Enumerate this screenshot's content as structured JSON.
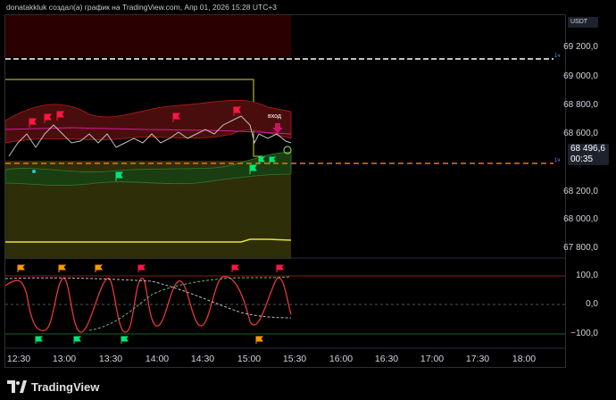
{
  "header": {
    "caption": "donatakkluk создал(а) график на TradingView.com, Апр 01, 2026 15:28 UTC+3"
  },
  "chart": {
    "currency_label": "USDT",
    "last_price": "68 496,6",
    "countdown": "00:35",
    "entry_annotation": "вход",
    "price_axis_labels": [
      "69 200,0",
      "69 000,0",
      "68 800,0",
      "68 600,0",
      "68 200,0",
      "68 000,0",
      "67 800,0"
    ],
    "osc_axis_labels": [
      "100,0",
      "0,0",
      "−100,0"
    ],
    "time_axis_labels": [
      "12:30",
      "13:00",
      "13:30",
      "14:00",
      "14:30",
      "15:00",
      "15:30",
      "16:00",
      "16:30",
      "17:00",
      "17:30",
      "18:00"
    ],
    "line_tag_1": "1ч",
    "line_tag_2": "1ч"
  },
  "colors": {
    "background": "#000000",
    "bull_flag": "#00e676",
    "bear_flag": "#ff1744",
    "fill_olive": "#3a3a0a",
    "upper_band": "#8b1a1a",
    "lower_band": "#1b5e20",
    "accent_orange": "#ff6d00"
  },
  "footer": {
    "brand": "TradingView"
  },
  "chart_data": {
    "type": "line",
    "x": [
      "12:30",
      "13:00",
      "13:30",
      "14:00",
      "14:30",
      "15:00",
      "15:30"
    ],
    "series": [
      {
        "values": [
          68560,
          68640,
          68560,
          68580,
          68600,
          68700,
          68520
        ]
      }
    ],
    "ylim": [
      67750,
      69300
    ],
    "ylabel": "",
    "xlabel": ""
  }
}
